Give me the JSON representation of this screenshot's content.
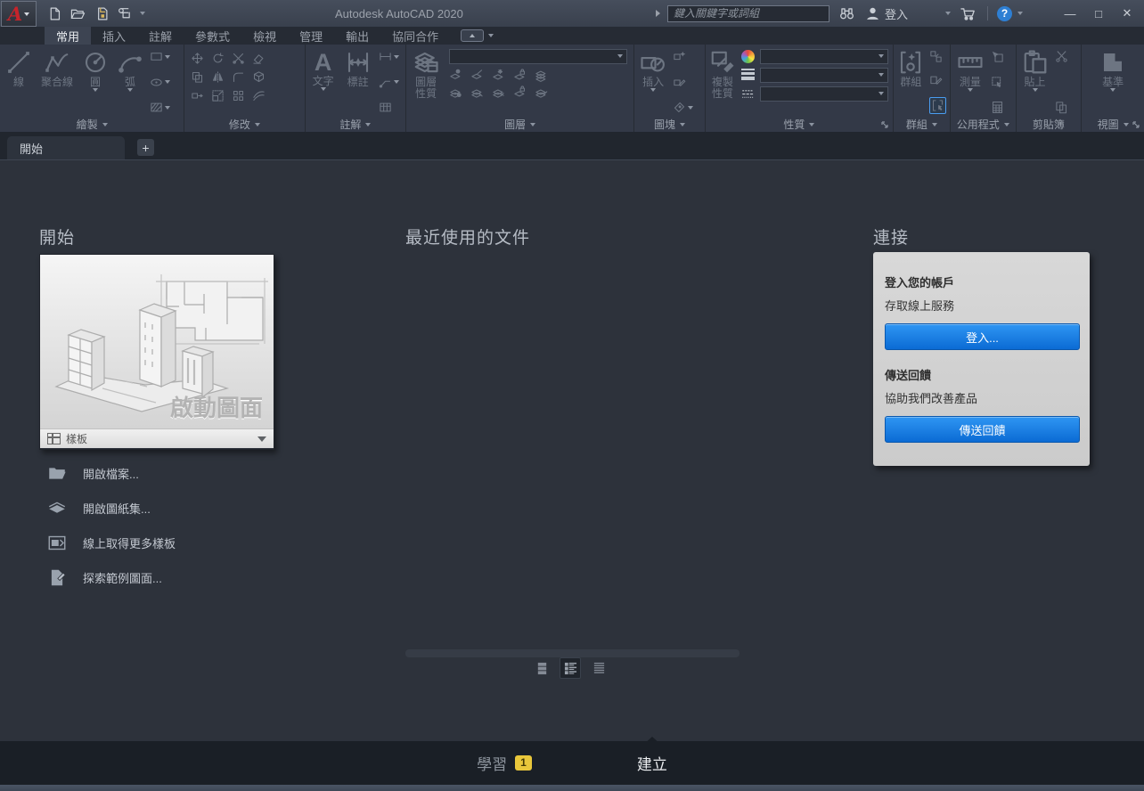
{
  "window": {
    "title": "Autodesk AutoCAD 2020",
    "minimize": "—",
    "maximize": "□",
    "close": "✕"
  },
  "topbar": {
    "search_placeholder": "鍵入關鍵字或詞組",
    "sign_in": "登入"
  },
  "ribbon": {
    "tabs": [
      {
        "label": "常用"
      },
      {
        "label": "插入"
      },
      {
        "label": "註解"
      },
      {
        "label": "參數式"
      },
      {
        "label": "檢視"
      },
      {
        "label": "管理"
      },
      {
        "label": "輸出"
      },
      {
        "label": "協同合作"
      }
    ],
    "panels": [
      {
        "label": "繪製",
        "tools": [
          {
            "label": "線"
          },
          {
            "label": "聚合線"
          },
          {
            "label": "圓"
          },
          {
            "label": "弧"
          }
        ]
      },
      {
        "label": "修改",
        "tools": []
      },
      {
        "label": "註解",
        "tools": [
          {
            "label": "文字"
          },
          {
            "label": "標註"
          }
        ]
      },
      {
        "label": "圖層",
        "tools": [
          {
            "label": "圖層性質"
          }
        ]
      },
      {
        "label": "圖塊",
        "tools": [
          {
            "label": "插入"
          }
        ]
      },
      {
        "label": "性質",
        "tools": [
          {
            "label": "複製性質"
          }
        ]
      },
      {
        "label": "群組",
        "tools": [
          {
            "label": "群組"
          }
        ]
      },
      {
        "label": "公用程式",
        "tools": [
          {
            "label": "測量"
          }
        ]
      },
      {
        "label": "剪貼簿",
        "tools": [
          {
            "label": "貼上"
          }
        ]
      },
      {
        "label": "視圖",
        "tools": [
          {
            "label": "基準"
          }
        ]
      }
    ]
  },
  "file_tabs": {
    "start": "開始",
    "new_tab": "+"
  },
  "start_page": {
    "start_heading": "開始",
    "card": {
      "caption": "啟動圖面",
      "template_label": "樣板"
    },
    "links": [
      {
        "label": "開啟檔案..."
      },
      {
        "label": "開啟圖紙集..."
      },
      {
        "label": "線上取得更多樣板"
      },
      {
        "label": "探索範例圖面..."
      }
    ],
    "recent_heading": "最近使用的文件",
    "connect_heading": "連接",
    "connect": {
      "account_title": "登入您的帳戶",
      "account_desc": "存取線上服務",
      "sign_in_button": "登入...",
      "feedback_title": "傳送回饋",
      "feedback_desc": "協助我們改善產品",
      "feedback_button": "傳送回饋"
    },
    "footer": {
      "learn": "學習",
      "learn_badge": "1",
      "create": "建立"
    }
  },
  "colors": {
    "accent_blue": "#0b6bd4",
    "badge_yellow": "#e9c73b",
    "logo_red": "#c6242b"
  }
}
